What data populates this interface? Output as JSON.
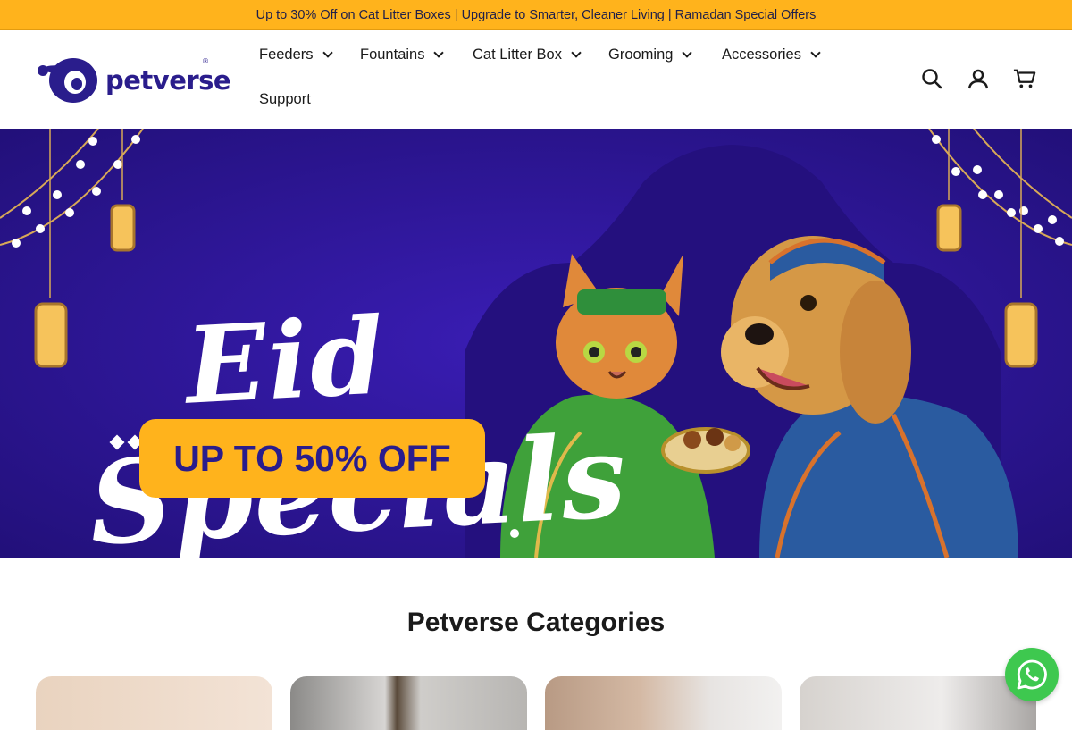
{
  "announcement": {
    "text": "Up to 30% Off on Cat Litter Boxes | Upgrade to Smarter, Cleaner Living | Ramadan Special Offers"
  },
  "brand": {
    "name": "petverse",
    "reg": "®",
    "accent": "#2a1d8c",
    "highlight": "#ffb31c"
  },
  "nav": {
    "items": [
      {
        "label": "Feeders",
        "has_dropdown": true
      },
      {
        "label": "Fountains",
        "has_dropdown": true
      },
      {
        "label": "Cat Litter Box",
        "has_dropdown": true
      },
      {
        "label": "Grooming",
        "has_dropdown": true
      },
      {
        "label": "Accessories",
        "has_dropdown": true
      },
      {
        "label": "Support",
        "has_dropdown": false
      }
    ]
  },
  "header_icons": [
    "search-icon",
    "account-icon",
    "cart-icon"
  ],
  "hero": {
    "title_line1": "Eid",
    "title_line2": "Specials",
    "cta": "UP TO 50% OFF",
    "background": "#2b1597"
  },
  "categories": {
    "title": "Petverse Categories",
    "cards": [
      {
        "color": "#e8d3c0"
      },
      {
        "color": "#9a9aa0"
      },
      {
        "color": "#c8aa95"
      },
      {
        "color": "#d9d4d0"
      }
    ]
  },
  "whatsapp": {
    "icon": "whatsapp-icon",
    "color": "#3ec84f"
  }
}
